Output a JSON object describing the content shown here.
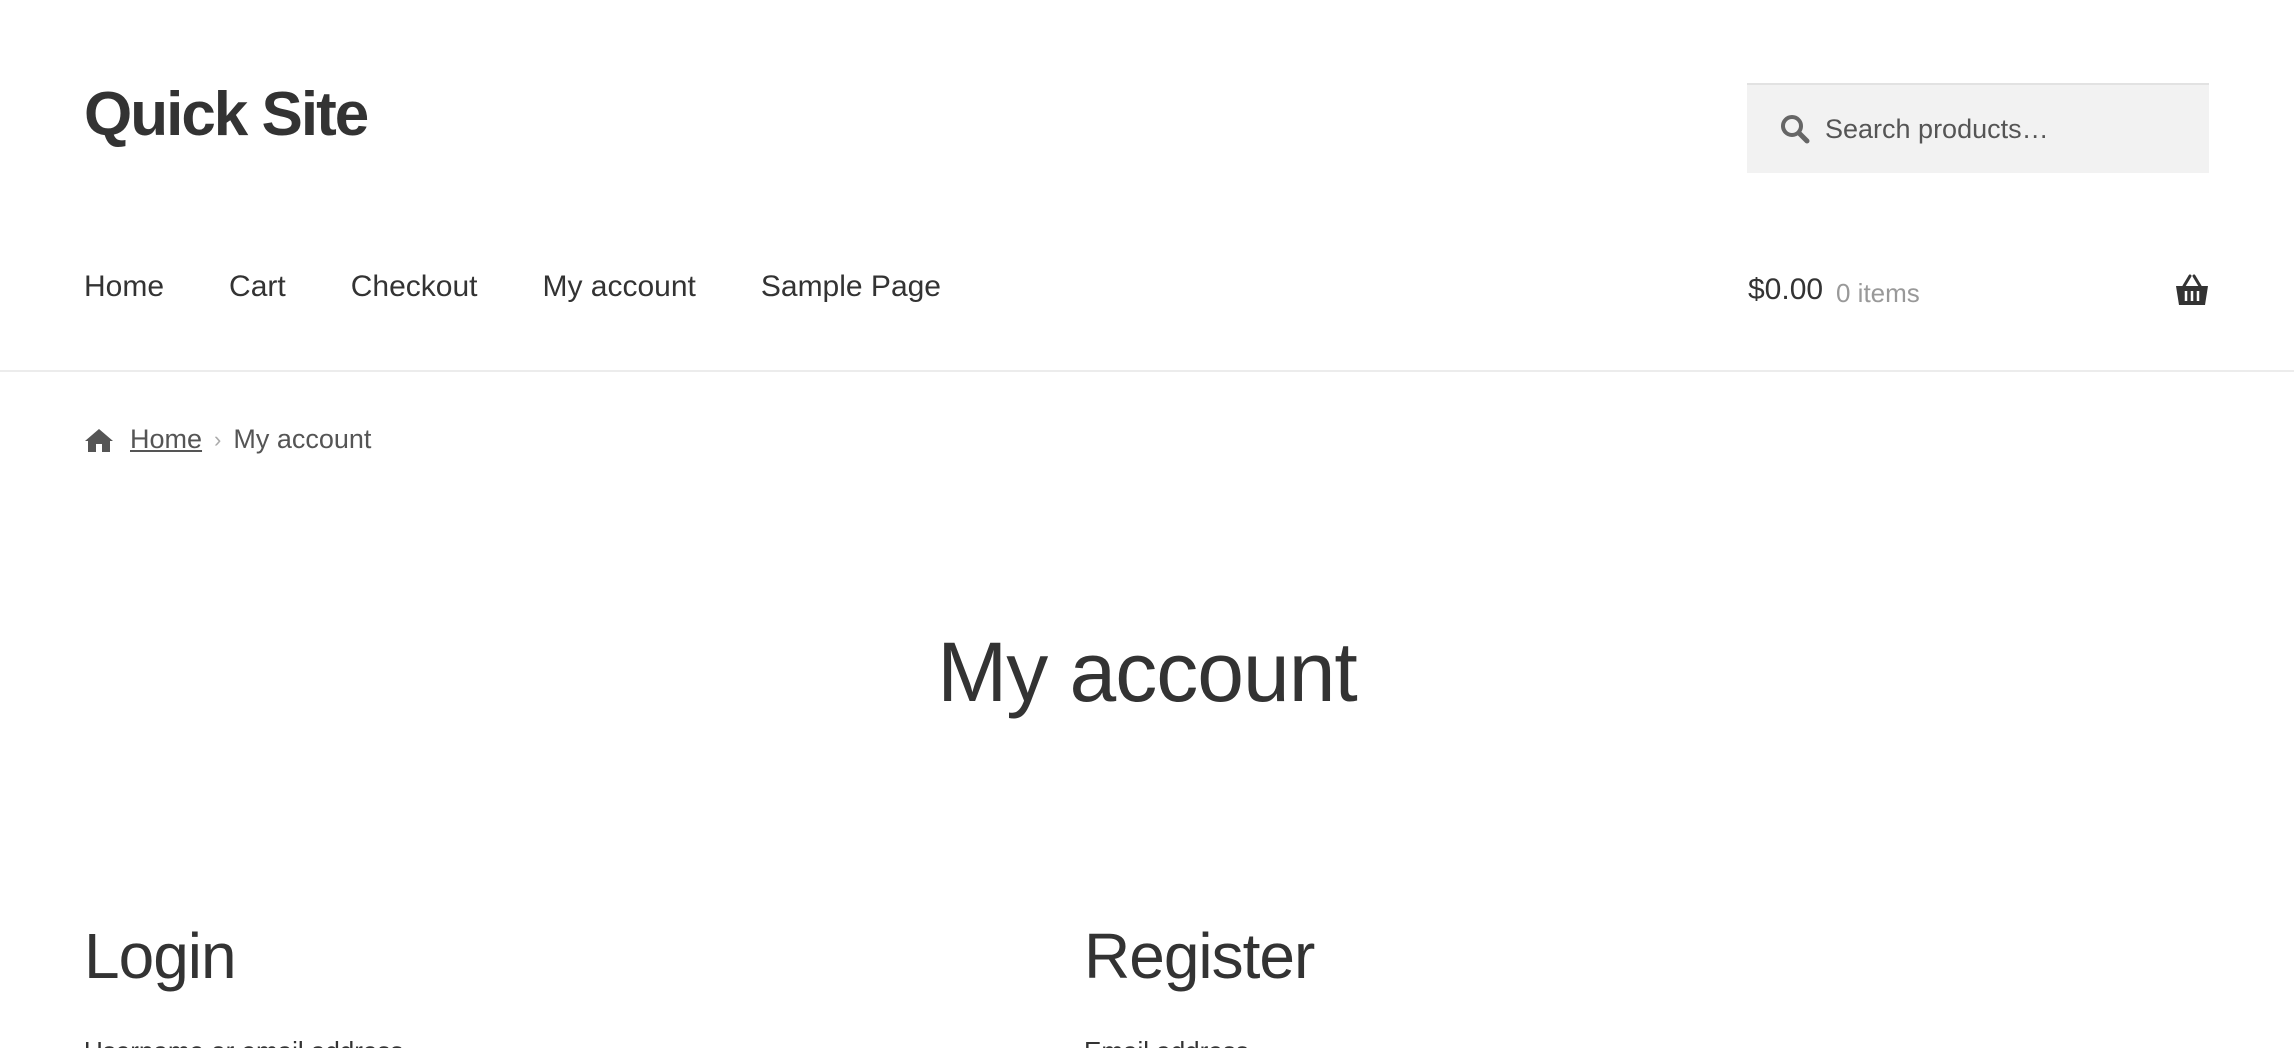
{
  "header": {
    "site_title": "Quick Site",
    "search": {
      "placeholder": "Search products…",
      "value": ""
    }
  },
  "nav": {
    "items": [
      {
        "label": "Home"
      },
      {
        "label": "Cart"
      },
      {
        "label": "Checkout"
      },
      {
        "label": "My account"
      },
      {
        "label": "Sample Page"
      }
    ]
  },
  "cart": {
    "amount": "$0.00",
    "count": "0 items"
  },
  "breadcrumb": {
    "home_label": "Home",
    "separator": "›",
    "current": "My account"
  },
  "main": {
    "title": "My account",
    "login_heading": "Login",
    "register_heading": "Register",
    "login_sub": "Username or email address",
    "register_sub": "Email address"
  },
  "icons": {
    "search": "search-icon",
    "basket": "basket-icon",
    "home": "home-icon"
  },
  "colors": {
    "text": "#333333",
    "muted": "#999999",
    "search_bg": "#f2f2f2",
    "divider": "#ececec"
  }
}
